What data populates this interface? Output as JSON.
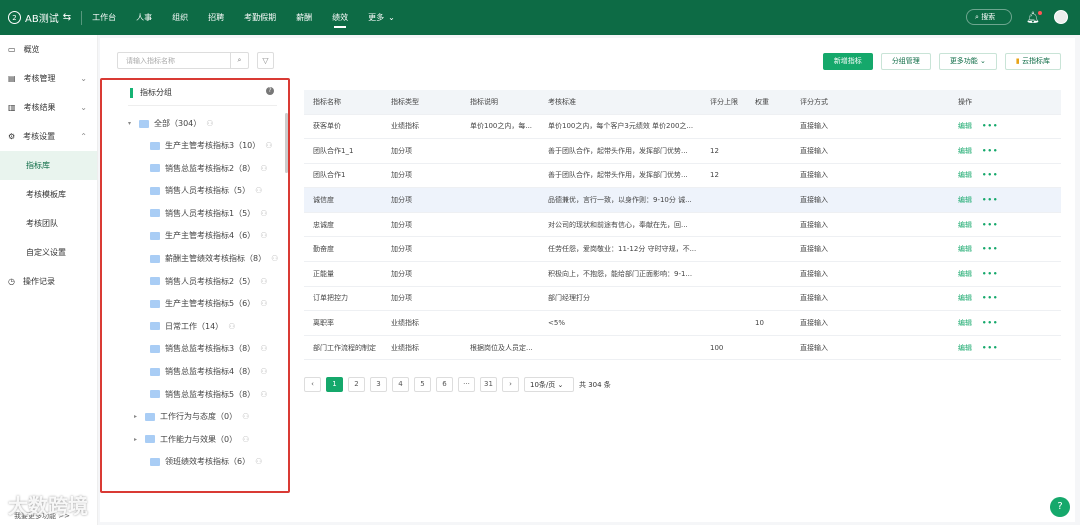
{
  "header": {
    "app": "AB测试",
    "logo_badge": "2",
    "nav": [
      "工作台",
      "人事",
      "组织",
      "招聘",
      "考勤假期",
      "薪酬",
      "绩效",
      "更多"
    ],
    "active": "绩效",
    "search": "搜索"
  },
  "sidebar": {
    "items": [
      {
        "label": "概览"
      },
      {
        "label": "考核管理"
      },
      {
        "label": "考核结果"
      },
      {
        "label": "考核设置"
      },
      {
        "label": "指标库"
      },
      {
        "label": "考核模板库"
      },
      {
        "label": "考核团队"
      },
      {
        "label": "自定义设置"
      },
      {
        "label": "操作记录"
      }
    ],
    "footer": "我要更多功能 >>"
  },
  "search": {
    "placeholder": "请输入指标名称"
  },
  "tree": {
    "title": "指标分组",
    "root": "全部（304）",
    "items": [
      {
        "label": "生产主管考核指标3（10）",
        "expand": false
      },
      {
        "label": "销售总监考核指标2（8）",
        "expand": false
      },
      {
        "label": "销售人员考核指标（5）",
        "expand": false
      },
      {
        "label": "销售人员考核指标1（5）",
        "expand": false
      },
      {
        "label": "生产主管考核指标4（6）",
        "expand": false
      },
      {
        "label": "薪酬主管绩效考核指标（8）",
        "expand": false
      },
      {
        "label": "销售人员考核指标2（5）",
        "expand": false
      },
      {
        "label": "生产主管考核指标5（6）",
        "expand": false
      },
      {
        "label": "日常工作（14）",
        "expand": false
      },
      {
        "label": "销售总监考核指标3（8）",
        "expand": false
      },
      {
        "label": "销售总监考核指标4（8）",
        "expand": false
      },
      {
        "label": "销售总监考核指标5（8）",
        "expand": false
      },
      {
        "label": "工作行为与态度（0）",
        "expand": true
      },
      {
        "label": "工作能力与效果（0）",
        "expand": true
      },
      {
        "label": "领班绩效考核指标（6）",
        "expand": false
      }
    ]
  },
  "toolbar": {
    "add": "新增指标",
    "group": "分组管理",
    "more": "更多功能",
    "cloud": "云指标库"
  },
  "table": {
    "columns": [
      "指标名称",
      "指标类型",
      "指标说明",
      "考核标准",
      "评分上限",
      "权重",
      "评分方式",
      "操作"
    ],
    "edit": "编辑",
    "more": "•••",
    "rows": [
      [
        "获客单价",
        "业绩指标",
        "单价100之内，每...",
        "单价100之内，每个客户3元绩效 单价200之...",
        "",
        "",
        "直接输入"
      ],
      [
        "团队合作1_1",
        "加分项",
        "",
        "善于团队合作，起带头作用，发挥部门优势...",
        "12",
        "",
        "直接输入"
      ],
      [
        "团队合作1",
        "加分项",
        "",
        "善于团队合作，起带头作用，发挥部门优势...",
        "12",
        "",
        "直接输入"
      ],
      [
        "诚信度",
        "加分项",
        "",
        "品德兼优，言行一致，以身作则：9-10分 诚...",
        "",
        "",
        "直接输入"
      ],
      [
        "忠诚度",
        "加分项",
        "",
        "对公司的现状和前途有信心，奉献在先，回...",
        "",
        "",
        "直接输入"
      ],
      [
        "勤奋度",
        "加分项",
        "",
        "任劳任怨，爱岗敬业：11-12分 守时守规，不...",
        "",
        "",
        "直接输入"
      ],
      [
        "正能量",
        "加分项",
        "",
        "积极向上，不抱怨，能给部门正面影响：9-1...",
        "",
        "",
        "直接输入"
      ],
      [
        "订单把控力",
        "加分项",
        "",
        "部门经理打分",
        "",
        "",
        "直接输入"
      ],
      [
        "离职率",
        "业绩指标",
        "",
        "<5%",
        "",
        "10",
        "直接输入"
      ],
      [
        "部门工作流程的制定",
        "业绩指标",
        "根据岗位及人员定...",
        "",
        "100",
        "",
        "直接输入"
      ]
    ]
  },
  "pagination": {
    "pages": [
      "1",
      "2",
      "3",
      "4",
      "5",
      "6",
      "···",
      "31"
    ],
    "current": "1",
    "page_size": "10条/页",
    "total": "共 304 条"
  },
  "watermark_logo": "大数跨境"
}
